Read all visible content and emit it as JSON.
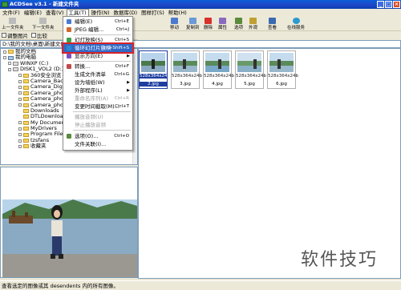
{
  "window": {
    "title": "ACDSee v3.1 - 新建文件夹",
    "controls": [
      "_",
      "□",
      "×"
    ]
  },
  "menubar": [
    "文件(F)",
    "编辑(E)",
    "查看(V)",
    "工具(T)",
    "操作(N)",
    "数据库(D)",
    "图样打(S)",
    "帮助(H)"
  ],
  "toolbar": {
    "back": "上一文件夹",
    "next": "下一文件夹",
    "buttons": [
      "移动",
      "复制到",
      "删除",
      "属性",
      "选项",
      "外观",
      "查看",
      "在线服务"
    ],
    "browse": "调整图片",
    "compare": "比较"
  },
  "address": "D:\\我的文档\\桌面\\新建文件夹",
  "tree": [
    {
      "label": "我的文档"
    },
    {
      "label": "我的电脑"
    },
    {
      "label": "WINXP (C:)"
    },
    {
      "label": "DISK1_VOL2 (D:)"
    },
    {
      "label": "360安全浏览"
    },
    {
      "label": "Camera_Back"
    },
    {
      "label": "Camera_Digi"
    },
    {
      "label": "Camera_phot"
    },
    {
      "label": "Camera_phot"
    },
    {
      "label": "Camera_phot"
    },
    {
      "label": "Downloads"
    },
    {
      "label": "DTLDownload"
    },
    {
      "label": "My Documents"
    },
    {
      "label": "MyDrivers"
    },
    {
      "label": "Program Files"
    },
    {
      "label": "tzsfans"
    },
    {
      "label": "收藏夹"
    }
  ],
  "thumbnails": [
    {
      "dims": "528x364x24b",
      "name": "2.jpg",
      "selected": true
    },
    {
      "dims": "528x364x24b",
      "name": "3.jpg",
      "selected": false
    },
    {
      "dims": "528x364x24b",
      "name": "4.jpg",
      "selected": false
    },
    {
      "dims": "528x364x24b",
      "name": "5.jpg",
      "selected": false
    },
    {
      "dims": "528x364x24b",
      "name": "6.jpg",
      "selected": false
    }
  ],
  "tools_menu": [
    {
      "label": "编辑(E)",
      "shortcut": "Ctrl+E",
      "icon": "edit-icon",
      "color": "#4a7ad0"
    },
    {
      "label": "JPEG 编辑...",
      "shortcut": "Ctrl+J",
      "icon": "jpeg-icon",
      "color": "#d06a2a"
    },
    {
      "label": "幻灯放映(S)",
      "shortcut": "Ctrl+S",
      "icon": "slideshow-icon",
      "color": "#3aa04a"
    },
    {
      "label": "循环幻灯片放映",
      "shortcut": "Ctrl+Shift+S",
      "icon": "loop-icon",
      "color": "#2a8ad0",
      "highlighted": true
    },
    {
      "label": "显示方向(E)",
      "shortcut": "",
      "icon": "orientation-icon",
      "submenu": true,
      "color": "#7a50c0"
    },
    {
      "label": "转换...",
      "shortcut": "Ctrl+F",
      "icon": "convert-icon",
      "color": "#c04a4a"
    },
    {
      "label": "生成文件清单",
      "shortcut": "Ctrl+G",
      "icon": "",
      "color": ""
    },
    {
      "label": "设为墙纸(W)",
      "shortcut": "",
      "icon": "",
      "submenu": true,
      "color": ""
    },
    {
      "label": "外部程序(L)",
      "shortcut": "",
      "icon": "",
      "submenu": true,
      "color": ""
    },
    {
      "label": "重命名序列(A)",
      "shortcut": "Ctrl+R",
      "icon": "",
      "color": "",
      "disabled": true
    },
    {
      "label": "变更时间截取(M)...",
      "shortcut": "Ctrl+T",
      "icon": "",
      "color": ""
    },
    {
      "label": "播放音频(U)",
      "shortcut": "",
      "icon": "",
      "color": "",
      "disabled": true
    },
    {
      "label": "停止播放音频",
      "shortcut": "",
      "icon": "",
      "color": "",
      "disabled": true
    },
    {
      "label": "选项(O)...",
      "shortcut": "Ctrl+O",
      "icon": "options-icon",
      "color": "#5a8a3a"
    },
    {
      "label": "文件关联(I)...",
      "shortcut": "",
      "icon": "",
      "color": ""
    }
  ],
  "status": "查看选定的图像或其 desendents 内的所有图像。",
  "watermark": "软件技巧",
  "colors": {
    "titlebar": "#1f46c8",
    "menu_highlight": "#316ac5",
    "highlight_outline": "#d8222a",
    "selection": "#1e3ea0"
  }
}
